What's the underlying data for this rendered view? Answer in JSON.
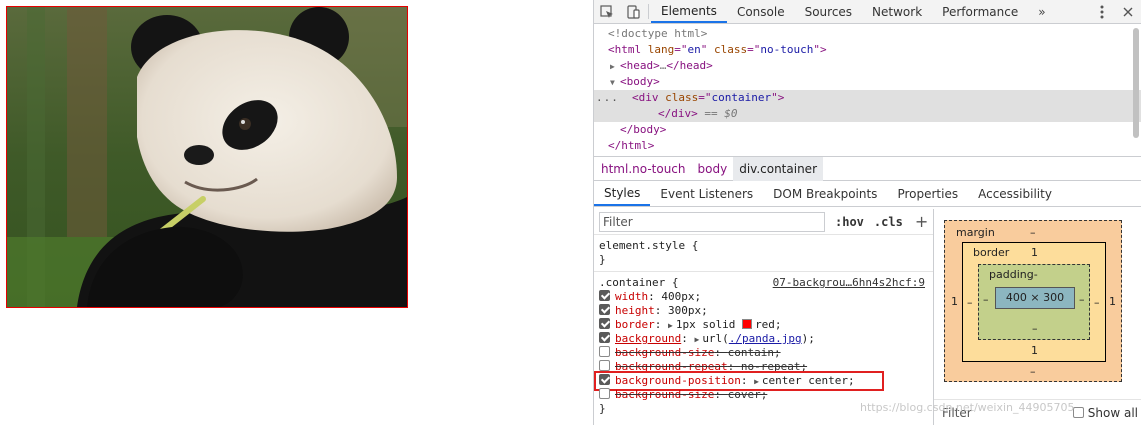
{
  "devtools": {
    "tabs": [
      "Elements",
      "Console",
      "Sources",
      "Network",
      "Performance"
    ],
    "more_label": "»",
    "dom": {
      "doctype": "<!doctype html>",
      "html_open": {
        "tag": "html",
        "attr1": "lang",
        "val1": "en",
        "attr2": "class",
        "val2": "no-touch"
      },
      "head": "head",
      "head_ellipsis": "…",
      "body": "body",
      "div": {
        "tag": "div",
        "attr": "class",
        "val": "container"
      },
      "div_close": "</div>",
      "selected_marker": "== $0",
      "body_close": "</body>",
      "html_close": "</html>",
      "dots": "..."
    },
    "breadcrumbs": [
      "html.no-touch",
      "body",
      "div.container"
    ],
    "subtabs": [
      "Styles",
      "Event Listeners",
      "DOM Breakpoints",
      "Properties",
      "Accessibility"
    ],
    "filter_placeholder": "Filter",
    "hov": ":hov",
    "cls": ".cls",
    "plus": "+",
    "element_style": {
      "selector": "element.style {",
      "close": "}"
    },
    "container_rule": {
      "selector": ".container {",
      "source": "07-backgrou…6hn4s2hcf:9",
      "close": "}",
      "props": [
        {
          "name": "width",
          "value": "400px;"
        },
        {
          "name": "height",
          "value": "300px;"
        },
        {
          "name": "border",
          "pre": "1px solid",
          "color_name": "red;"
        },
        {
          "name": "background",
          "pre": "url(",
          "url": "./panda.jpg",
          "post": ");"
        },
        {
          "name": "background-size",
          "value": "contain;"
        },
        {
          "name": "background-repeat",
          "value": "no-repeat;"
        },
        {
          "name": "background-position",
          "value": "center center;"
        },
        {
          "name": "background-size",
          "value": "cover;"
        }
      ]
    },
    "box_model": {
      "margin_label": "margin",
      "margin_top": "–",
      "margin_bottom": "–",
      "margin_left": "1",
      "margin_right": "1",
      "border_label": "border",
      "border_top": "1",
      "border_bottom": "1",
      "border_left": "–",
      "border_right": "–",
      "padding_label": "padding-",
      "padding_bottom": "–",
      "padding_left": "–",
      "padding_right": "–",
      "content": "400 × 300"
    },
    "filter_label": "Filter",
    "show_all": "Show all"
  },
  "watermark": "https://blog.csdn.net/weixin_44905705"
}
